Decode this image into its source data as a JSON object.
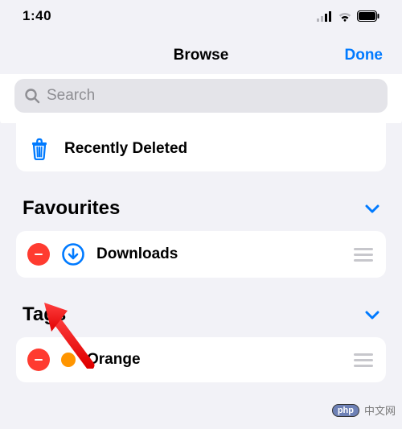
{
  "statusbar": {
    "time": "1:40"
  },
  "nav": {
    "title": "Browse",
    "done": "Done"
  },
  "search": {
    "placeholder": "Search"
  },
  "recently_deleted": {
    "label": "Recently Deleted"
  },
  "favourites": {
    "title": "Favourites",
    "items": [
      {
        "label": "Downloads"
      }
    ]
  },
  "tags": {
    "title": "Tags",
    "items": [
      {
        "label": "Orange",
        "color": "#ff9500"
      }
    ]
  },
  "watermark": {
    "pill": "php",
    "text": "中文网"
  }
}
